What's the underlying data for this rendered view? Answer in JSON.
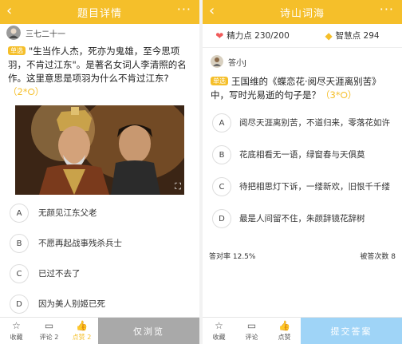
{
  "left": {
    "header": {
      "back_icon": "‹",
      "title": "题目详情",
      "more_icon": "···"
    },
    "author": {
      "name": "三七二十一"
    },
    "question": {
      "tag": "单选",
      "text": "\"生当作人杰，死亦为鬼雄，至今思项羽，不肯过江东\"。是著名女词人李清照的名作。这里意思是项羽为什么不肯过江东?",
      "reward": "（2*⭘）"
    },
    "image": {
      "fullscreen_icon": "⛶"
    },
    "options": [
      {
        "key": "A",
        "text": "无颜见江东父老"
      },
      {
        "key": "B",
        "text": "不愿再起战事残杀兵士"
      },
      {
        "key": "C",
        "text": "已过不去了"
      },
      {
        "key": "D",
        "text": "因为美人别姬已死"
      }
    ],
    "toolbar": {
      "favorite": {
        "icon": "☆",
        "label": "收藏"
      },
      "comment": {
        "icon": "▭",
        "label": "评论 2"
      },
      "like": {
        "icon": "👍",
        "label": "点赞 2"
      },
      "action_label": "仅浏览"
    }
  },
  "right": {
    "header": {
      "back_icon": "‹",
      "title": "诗山词海",
      "more_icon": "···"
    },
    "stats": {
      "energy_label": "精力点 230/200",
      "wisdom_label": "智慧点 294"
    },
    "author": {
      "name": "答小J"
    },
    "question": {
      "tag": "单选",
      "text": "王国维的《蝶恋花·阅尽天涯离别苦》中，写时光易逝的句子是？",
      "reward": "（3*⭘）"
    },
    "options": [
      {
        "key": "A",
        "text": "阅尽天涯离别苦，不道归来，零落花如许"
      },
      {
        "key": "B",
        "text": "花底相看无一语，绿窗春与天俱莫"
      },
      {
        "key": "C",
        "text": "待把相思灯下诉，一缕新欢，旧恨千千缕"
      },
      {
        "key": "D",
        "text": "最是人间留不住，朱颜辞镜花辞树"
      }
    ],
    "footer": {
      "accuracy": "答对率 12.5%",
      "answered": "被答次数 8"
    },
    "toolbar": {
      "favorite": {
        "icon": "☆",
        "label": "收藏"
      },
      "comment": {
        "icon": "▭",
        "label": "评论"
      },
      "like": {
        "icon": "👍",
        "label": "点赞"
      },
      "action_label": "提交答案"
    }
  },
  "colors": {
    "accent": "#f5bf2a",
    "submit": "#9fd4f7",
    "browse": "#a9a9a9",
    "heart": "#f05a5a"
  }
}
